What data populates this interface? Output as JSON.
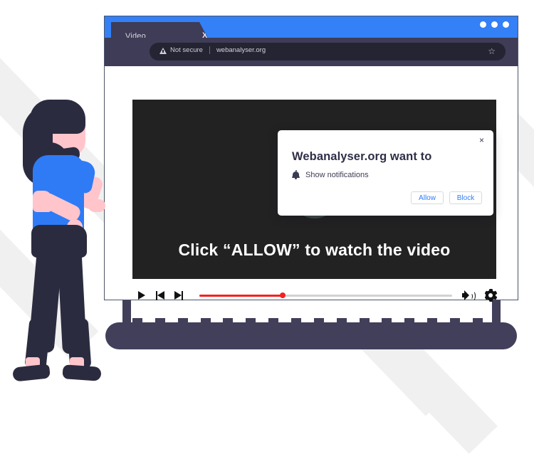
{
  "browser": {
    "tab": {
      "title": "Video",
      "close_label": "X"
    },
    "address_bar": {
      "security_label": "Not secure",
      "url": "webanalyser.org",
      "security_icon": "warning-triangle-icon",
      "bookmark_icon": "star-outline-icon"
    },
    "window_controls": {
      "icon": "three-dots-icon",
      "count": 3
    },
    "accent_color": "#3380f7",
    "chrome_color": "#3e3c56"
  },
  "dialog": {
    "title": "Webanalyser.org want to",
    "permission_label": "Show notifications",
    "permission_icon": "bell-icon",
    "close_label": "×",
    "allow_label": "Allow",
    "block_label": "Block",
    "button_text_color": "#2f7bf6"
  },
  "video": {
    "overlay_text": "Click “ALLOW” to watch the video",
    "play_icon": "play-triangle-icon",
    "background_color": "#222222",
    "play_circle_color": "#3f4a47"
  },
  "player_controls": {
    "play_icon": "play-icon",
    "previous_icon": "skip-previous-icon",
    "next_icon": "skip-next-icon",
    "volume_icon": "volume-icon",
    "settings_icon": "gear-icon",
    "progress_percent": 33,
    "progress_color": "#f52020"
  },
  "illustration": {
    "character": "walking-woman-illustration",
    "hair_color": "#2b2b40",
    "shirt_color": "#2f7bf6",
    "skin_color": "#ffc5cb"
  },
  "monitor": {
    "stand_color": "#413f5a",
    "teeth_count": 16
  }
}
